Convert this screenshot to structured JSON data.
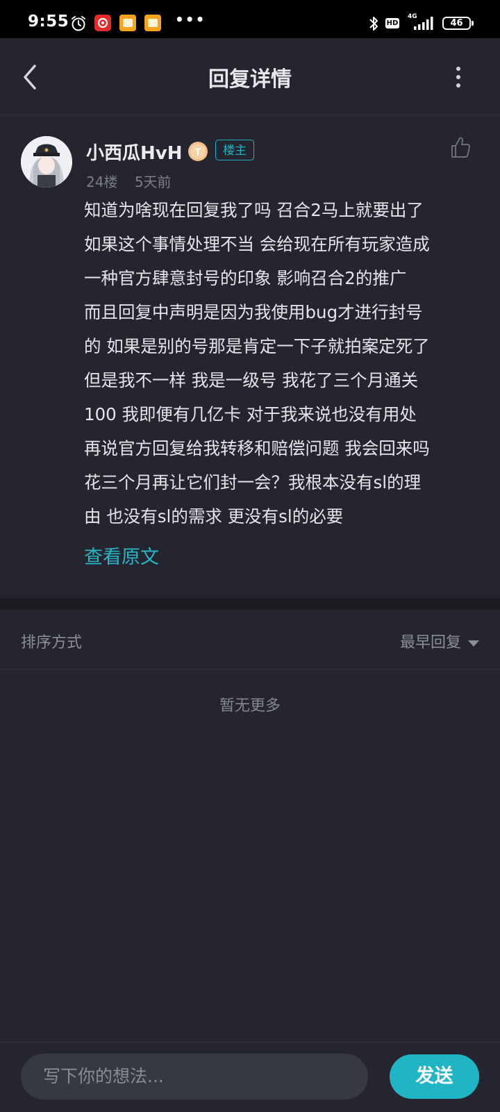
{
  "status_bar": {
    "time": "9:55",
    "network_label": "4G",
    "hd_label": "HD",
    "battery": "46",
    "icons": [
      "alarm-icon",
      "netease-music-icon",
      "notes-icon",
      "notes-icon",
      "more-dots-icon",
      "bluetooth-icon",
      "hd-icon",
      "signal-icon",
      "battery-icon"
    ]
  },
  "header": {
    "title": "回复详情",
    "back_icon": "back-arrow-icon",
    "more_icon": "more-vertical-icon"
  },
  "post": {
    "username": "小西瓜HvH",
    "level_badge_letter": "T",
    "op_badge": "楼主",
    "floor": "24楼",
    "time_ago": "5天前",
    "content_lines": [
      "知道为啥现在回复我了吗 召合2马上就要出了",
      "如果这个事情处理不当 会给现在所有玩家造成",
      "一种官方肆意封号的印象 影响召合2的推广",
      "而且回复中声明是因为我使用bug才进行封号",
      "的 如果是别的号那是肯定一下子就拍案定死了",
      "但是我不一样 我是一级号 我花了三个月通关",
      "100 我即便有几亿卡 对于我来说也没有用处",
      "再说官方回复给我转移和赔偿问题 我会回来吗",
      "花三个月再让它们封一会？我根本没有sl的理",
      "由 也没有sl的需求 更没有sl的必要"
    ],
    "view_original": "查看原文"
  },
  "sort": {
    "label": "排序方式",
    "selected": "最早回复"
  },
  "empty_text": "暂无更多",
  "composer": {
    "placeholder": "写下你的想法...",
    "send_label": "发送"
  },
  "colors": {
    "background": "#24252e",
    "accent": "#20b5c5",
    "text": "#e6e6ea",
    "muted": "#7b7d87"
  }
}
